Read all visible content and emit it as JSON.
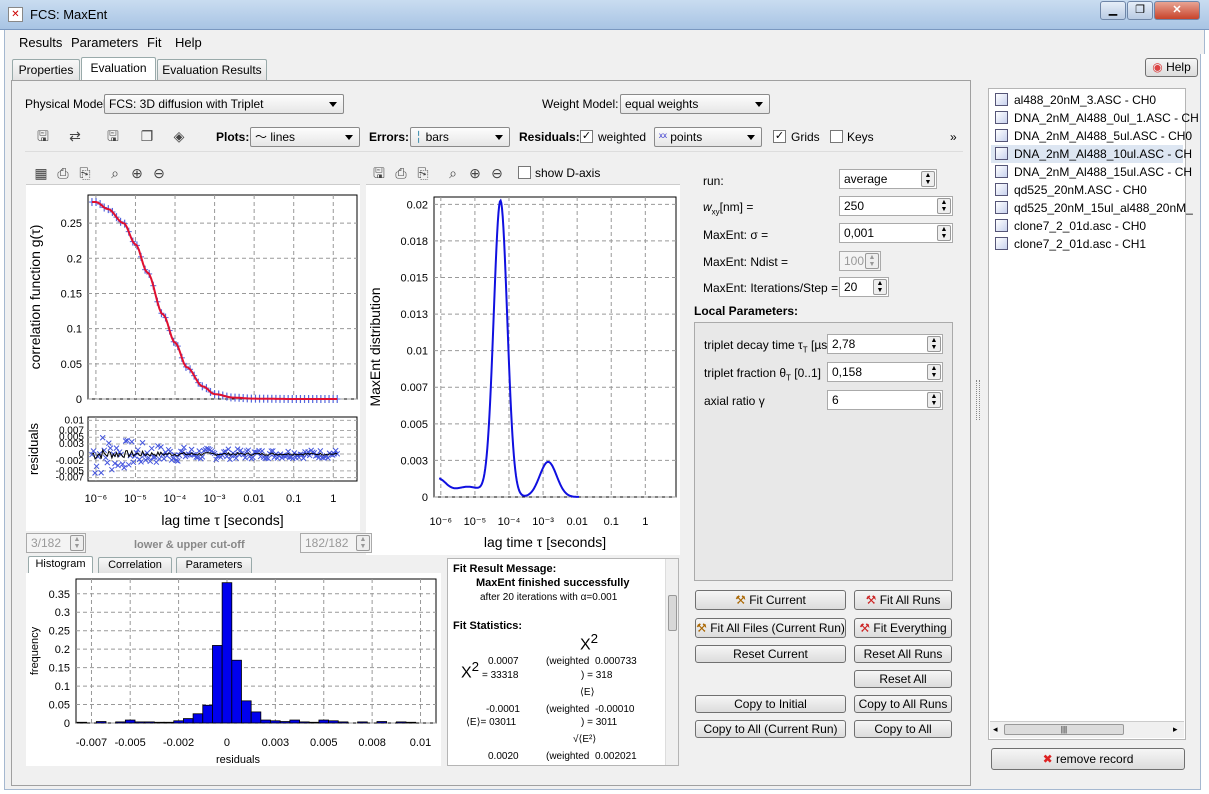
{
  "window": {
    "title": "FCS: MaxEnt",
    "minimize": "▁",
    "maximize": "❐",
    "close": "✕"
  },
  "menu": [
    "Results",
    "Parameters",
    "Fit",
    "Help"
  ],
  "tabs": [
    "Properties",
    "Evaluation",
    "Evaluation Results"
  ],
  "help_button": "Help",
  "physical_model": {
    "label": "Physical Model:",
    "value": "FCS: 3D diffusion with Triplet"
  },
  "weight_model": {
    "label": "Weight Model:",
    "value": "equal weights"
  },
  "toolbar": {
    "plots_label": "Plots:",
    "plots_value": "lines",
    "errors_label": "Errors:",
    "errors_value": "bars",
    "residuals_label": "Residuals:",
    "weighted": "weighted",
    "residuals_value": "points",
    "grids": "Grids",
    "keys": "Keys",
    "more": "»"
  },
  "maxent_plot": {
    "show_d_axis": "show D-axis"
  },
  "cutoff": {
    "lower": "3/182",
    "label": "lower & upper cut-off",
    "upper": "182/182"
  },
  "bottom_tabs": [
    "Histogram",
    "Correlation",
    "Parameters"
  ],
  "fit_result": {
    "title": "Fit Result Message:",
    "line1": "MaxEnt finished successfully",
    "line2": "after 20 iterations with α=0.001",
    "stats_title": "Fit Statistics:",
    "chi2_symbol": "X",
    "chi2_label": "2",
    "chi2_value": "0.0007",
    "chi2_sub": "= 33318",
    "chi2w_label": "(weighted",
    "chi2w_value": "0.000733",
    "chi2w_sub": ") = 318",
    "e_mean": "-0.0001",
    "e_sub": "⟨E⟩= 03011",
    "ew_label": "(weighted",
    "ew_value": "-0.00010",
    "ew_sub": ") = 3011",
    "e_sym": "⟨E⟩",
    "se_sym": "√⟨E²⟩",
    "se_value": "0.0020",
    "sew_label": "(weighted",
    "sew_value": "0.002021"
  },
  "params": {
    "run_label": "run:",
    "run_value": "average",
    "wxy_label": "w",
    "wxy_sub": "xy",
    "wxy_unit": "[nm]  =",
    "wxy_value": "250",
    "sigma_label": "MaxEnt: σ =",
    "sigma_value": "0,001",
    "ndist_label": "MaxEnt: Ndist =",
    "ndist_value": "100",
    "iter_label": "MaxEnt: Iterations/Step =",
    "iter_value": "20",
    "local_title": "Local Parameters:",
    "local": [
      {
        "label": "triplet decay time τ",
        "sub": "T",
        "unit": " [µs]",
        "value": "2,78"
      },
      {
        "label": "triplet fraction θ",
        "sub": "T",
        "unit": " [0..1]",
        "value": "0,158"
      },
      {
        "label": "axial ratio γ",
        "sub": "",
        "unit": "",
        "value": "6"
      }
    ]
  },
  "fit_buttons": {
    "fit_current": "Fit Current",
    "fit_all_runs": "Fit All Runs",
    "fit_all_files": "Fit All Files (Current Run)",
    "fit_everything": "Fit Everything",
    "reset_current": "Reset Current",
    "reset_all_runs": "Reset All Runs",
    "reset_all": "Reset All",
    "copy_initial": "Copy to Initial",
    "copy_all_runs": "Copy to All Runs",
    "copy_all_current": "Copy to All (Current Run)",
    "copy_all": "Copy to All"
  },
  "files": [
    "al488_20nM_3.ASC - CH0",
    "DNA_2nM_Al488_0ul_1.ASC - CH",
    "DNA_2nM_Al488_5ul.ASC - CH0",
    "DNA_2nM_Al488_10ul.ASC - CH",
    "DNA_2nM_Al488_15ul.ASC - CH",
    "qd525_20nM.ASC - CH0",
    "qd525_20nM_15ul_al488_20nM_",
    "clone7_2_01d.asc - CH0",
    "clone7_2_01d.asc - CH1"
  ],
  "remove_record": "remove record",
  "chart_data": [
    {
      "type": "scatter",
      "ylabel": "correlation function g(τ)",
      "xscale": "log",
      "x_ticks": [
        "10⁻⁶",
        "10⁻⁵",
        "10⁻⁴",
        "10⁻³",
        "0.01",
        "0.1",
        "1"
      ],
      "y_ticks": [
        "0",
        "0.05",
        "0.1",
        "0.15",
        "0.2",
        "0.25"
      ],
      "ylim": [
        0,
        0.29
      ],
      "series": [
        {
          "x": [
            1e-06,
            2e-06,
            5e-06,
            1e-05,
            2e-05,
            5e-05,
            0.0001,
            0.0002,
            0.0005,
            0.001,
            0.003,
            0.01,
            0.1,
            1
          ],
          "y": [
            0.28,
            0.27,
            0.25,
            0.22,
            0.18,
            0.12,
            0.08,
            0.045,
            0.018,
            0.007,
            0.002,
            0.0005,
            0.0,
            0.0
          ]
        }
      ]
    },
    {
      "type": "scatter",
      "ylabel": "residuals",
      "xlabel": "lag time τ [seconds]",
      "y_ticks": [
        "0.01",
        "0.007",
        "0.005",
        "0.003",
        "0",
        "-0.002",
        "-0.005",
        "-0.007"
      ],
      "ylim": [
        -0.008,
        0.011
      ]
    },
    {
      "type": "line",
      "ylabel": "MaxEnt distribution",
      "xlabel": "lag time τ [seconds]",
      "xscale": "log",
      "x_ticks": [
        "10⁻⁶",
        "10⁻⁵",
        "10⁻⁴",
        "10⁻³",
        "0.01",
        "0.1",
        "1"
      ],
      "y_ticks": [
        "0",
        "0.003",
        "0.005",
        "0.007",
        "0.01",
        "0.013",
        "0.015",
        "0.018",
        "0.02"
      ],
      "ylim": [
        0,
        0.0205
      ],
      "x": [
        1e-06,
        3e-06,
        1e-05,
        2e-05,
        4e-05,
        6e-05,
        0.0001,
        0.0002,
        0.0004,
        0.001,
        0.002,
        0.004,
        0.01
      ],
      "y": [
        0.0017,
        0.001,
        0.0013,
        0.006,
        0.018,
        0.0202,
        0.0135,
        0.0035,
        0.0019,
        0.0024,
        0.0024,
        0.0005,
        0.0
      ]
    },
    {
      "type": "bar",
      "xlabel": "residuals",
      "ylabel": "frequency",
      "x_ticks": [
        "-0.007",
        "-0.005",
        "-0.002",
        "0",
        "0.003",
        "0.005",
        "0.008",
        "0.01"
      ],
      "y_ticks": [
        "0",
        "0.05",
        "0.1",
        "0.15",
        "0.2",
        "0.25",
        "0.3",
        "0.35"
      ],
      "ylim": [
        0,
        0.39
      ],
      "bins": [
        -0.0075,
        -0.0065,
        -0.0055,
        -0.005,
        -0.0045,
        -0.004,
        -0.0035,
        -0.003,
        -0.0025,
        -0.002,
        -0.0015,
        -0.001,
        -0.0005,
        0,
        0.0005,
        0.001,
        0.0015,
        0.002,
        0.0025,
        0.003,
        0.0035,
        0.004,
        0.0045,
        0.005,
        0.0055,
        0.006,
        0.007,
        0.008,
        0.009,
        0.0095
      ],
      "values": [
        0.002,
        0.004,
        0.003,
        0.008,
        0.003,
        0.003,
        0.002,
        0.002,
        0.006,
        0.012,
        0.025,
        0.048,
        0.21,
        0.38,
        0.17,
        0.06,
        0.03,
        0.008,
        0.006,
        0.004,
        0.008,
        0.003,
        0.002,
        0.008,
        0.006,
        0.003,
        0.003,
        0.004,
        0.003,
        0.002
      ]
    }
  ]
}
